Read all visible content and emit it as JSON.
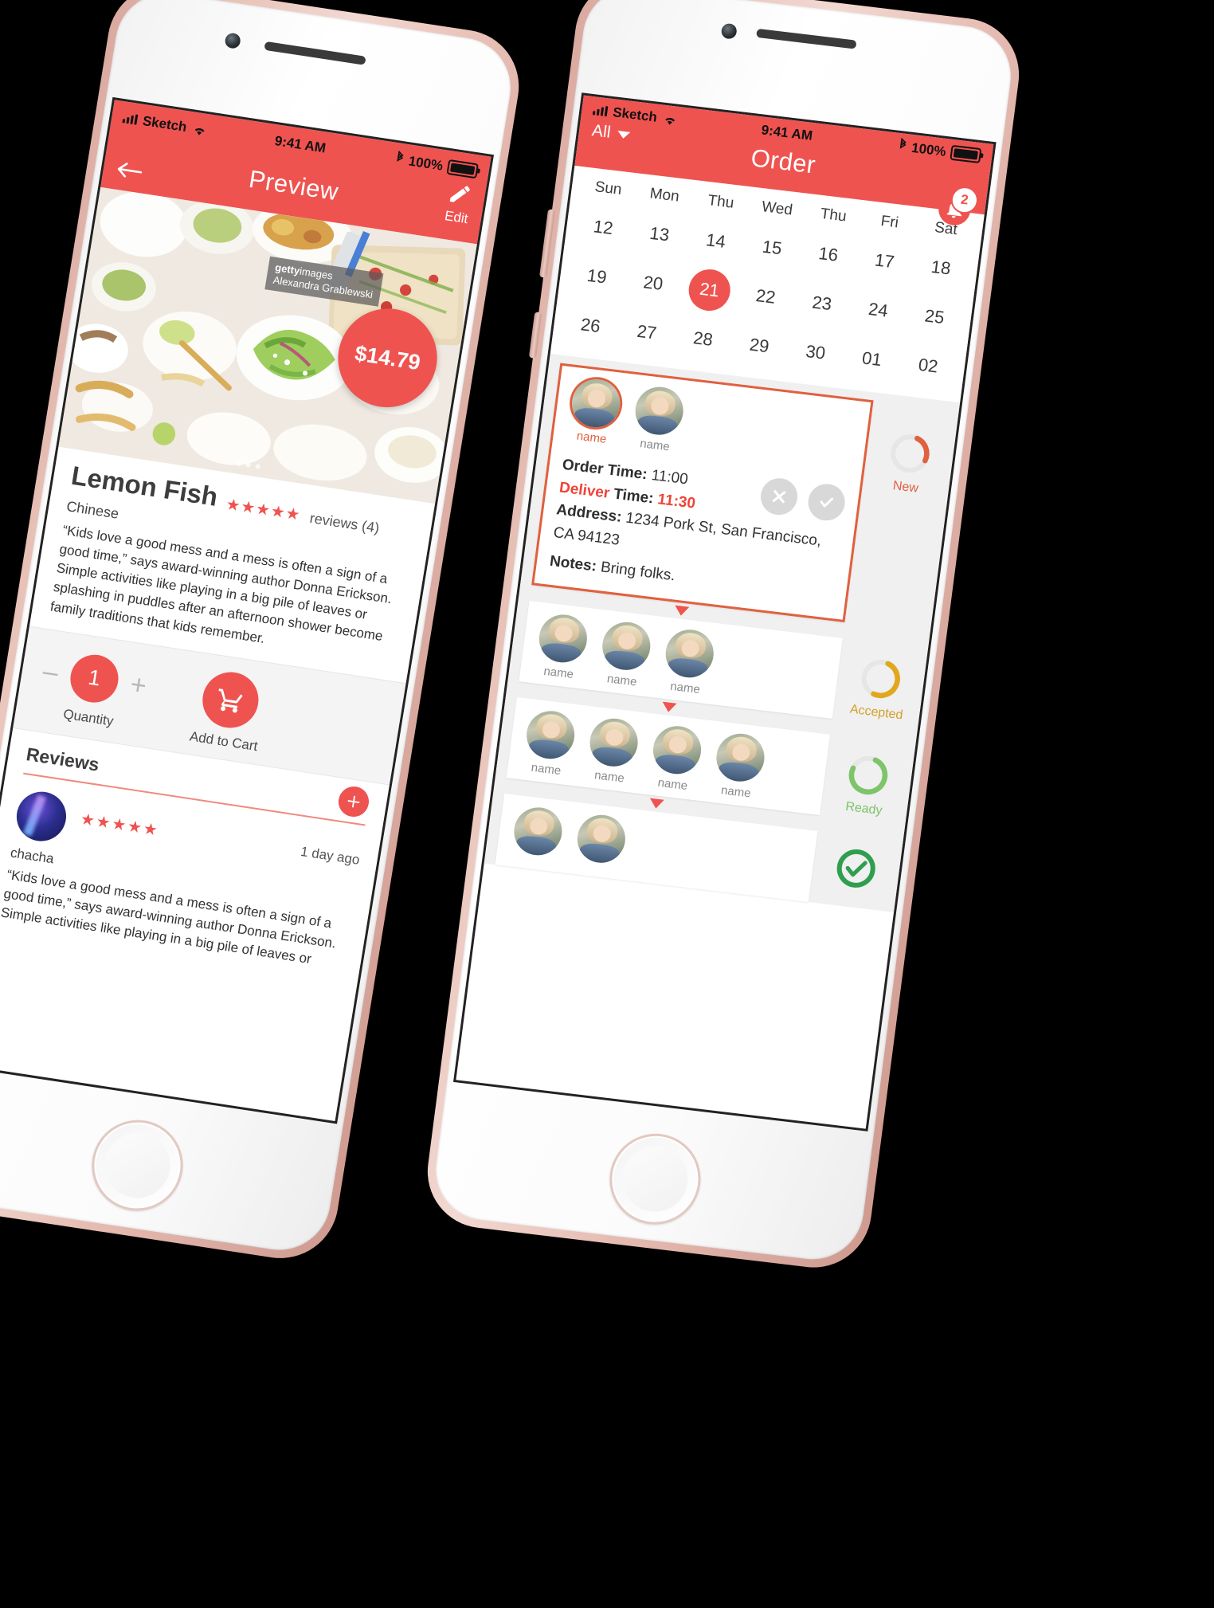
{
  "left_phone": {
    "status_bar": {
      "carrier": "Sketch",
      "time": "9:41 AM",
      "battery": "100%",
      "wifi_icon": "wifi-icon",
      "bluetooth_icon": "bluetooth-icon",
      "battery_icon": "battery-icon"
    },
    "nav": {
      "title": "Preview",
      "edit_label": "Edit",
      "edit_icon": "pencil-edit-icon",
      "back_icon": "back-arrow-icon"
    },
    "hero": {
      "price": "$14.79",
      "watermark_brand": "getty",
      "watermark_brand2": "images",
      "watermark_author": "Alexandra Grablewski"
    },
    "product": {
      "name": "Lemon Fish",
      "stars": "★★★★★",
      "reviews_label": "reviews (4)",
      "cuisine": "Chinese",
      "description": "“Kids love a good mess and a mess is often a sign of a good time,” says award-winning author Donna Erickson. Simple activities like playing in a big pile of leaves or splashing in puddles after an afternoon shower become family traditions that kids remember."
    },
    "quantity": {
      "minus": "–",
      "value": "1",
      "plus": "+",
      "label": "Quantity"
    },
    "cart": {
      "icon": "shopping-cart-icon",
      "label": "Add to Cart"
    },
    "reviews_section": {
      "heading": "Reviews",
      "add_icon": "plus-icon",
      "items": [
        {
          "user": "chacha",
          "stars": "★★★★★",
          "time": "1 day ago",
          "body": "“Kids love a good mess and a mess is often a sign of a good time,” says award-winning author Donna Erickson. Simple activities like playing in a big pile of leaves or"
        }
      ]
    }
  },
  "right_phone": {
    "status_bar": {
      "carrier": "Sketch",
      "time": "9:41 AM",
      "battery": "100%",
      "wifi_icon": "wifi-icon",
      "bluetooth_icon": "bluetooth-icon",
      "battery_icon": "battery-icon"
    },
    "nav": {
      "title": "Order",
      "filter_label": "All",
      "filter_caret": "chevron-down-icon",
      "bell_icon": "notification-bell-icon",
      "badge": "2"
    },
    "calendar": {
      "weekdays": [
        "Sun",
        "Mon",
        "Thu",
        "Wed",
        "Thu",
        "Fri",
        "Sat"
      ],
      "weeks": [
        [
          "12",
          "13",
          "14",
          "15",
          "16",
          "17",
          "18"
        ],
        [
          "19",
          "20",
          "21",
          "22",
          "23",
          "24",
          "25"
        ],
        [
          "26",
          "27",
          "28",
          "29",
          "30",
          "01",
          "02"
        ]
      ],
      "selected": "21"
    },
    "order_rows": [
      {
        "people": [
          {
            "name": "name",
            "highlight": true
          },
          {
            "name": "name",
            "highlight": false
          }
        ],
        "active": true,
        "order_time_label": "Order Time:",
        "order_time": "11:00",
        "deliver_label_a": "Deliver",
        "deliver_label_b": "Time:",
        "deliver_time": "11:30",
        "address_label": "Address:",
        "address": "1234 Pork St, San Francisco, CA 94123",
        "notes_label": "Notes:",
        "notes": "Bring folks.",
        "reject_icon": "close-x-icon",
        "accept_icon": "check-icon",
        "status": {
          "label": "New",
          "color": "#e0603f",
          "progress": 25
        }
      },
      {
        "people": [
          {
            "name": "name",
            "highlight": false
          },
          {
            "name": "name",
            "highlight": false
          },
          {
            "name": "name",
            "highlight": false
          }
        ],
        "active": false,
        "status": {
          "label": "Accepted",
          "color": "#e0a81e",
          "progress": 50
        }
      },
      {
        "people": [
          {
            "name": "name",
            "highlight": false
          },
          {
            "name": "name",
            "highlight": false
          },
          {
            "name": "name",
            "highlight": false
          },
          {
            "name": "name",
            "highlight": false
          }
        ],
        "active": false,
        "status": {
          "label": "Ready",
          "color": "#7dc46a",
          "progress": 75
        }
      },
      {
        "people": [
          {
            "name": "",
            "highlight": false
          },
          {
            "name": "",
            "highlight": false
          }
        ],
        "active": false,
        "status": {
          "label": "",
          "color": "#2f9e4f",
          "progress": 100
        }
      }
    ]
  },
  "theme": {
    "accent": "#ef5350",
    "active_border": "#e0603f",
    "new": "#e0603f",
    "accepted": "#e0a81e",
    "ready": "#7dc46a",
    "done": "#2f9e4f"
  }
}
